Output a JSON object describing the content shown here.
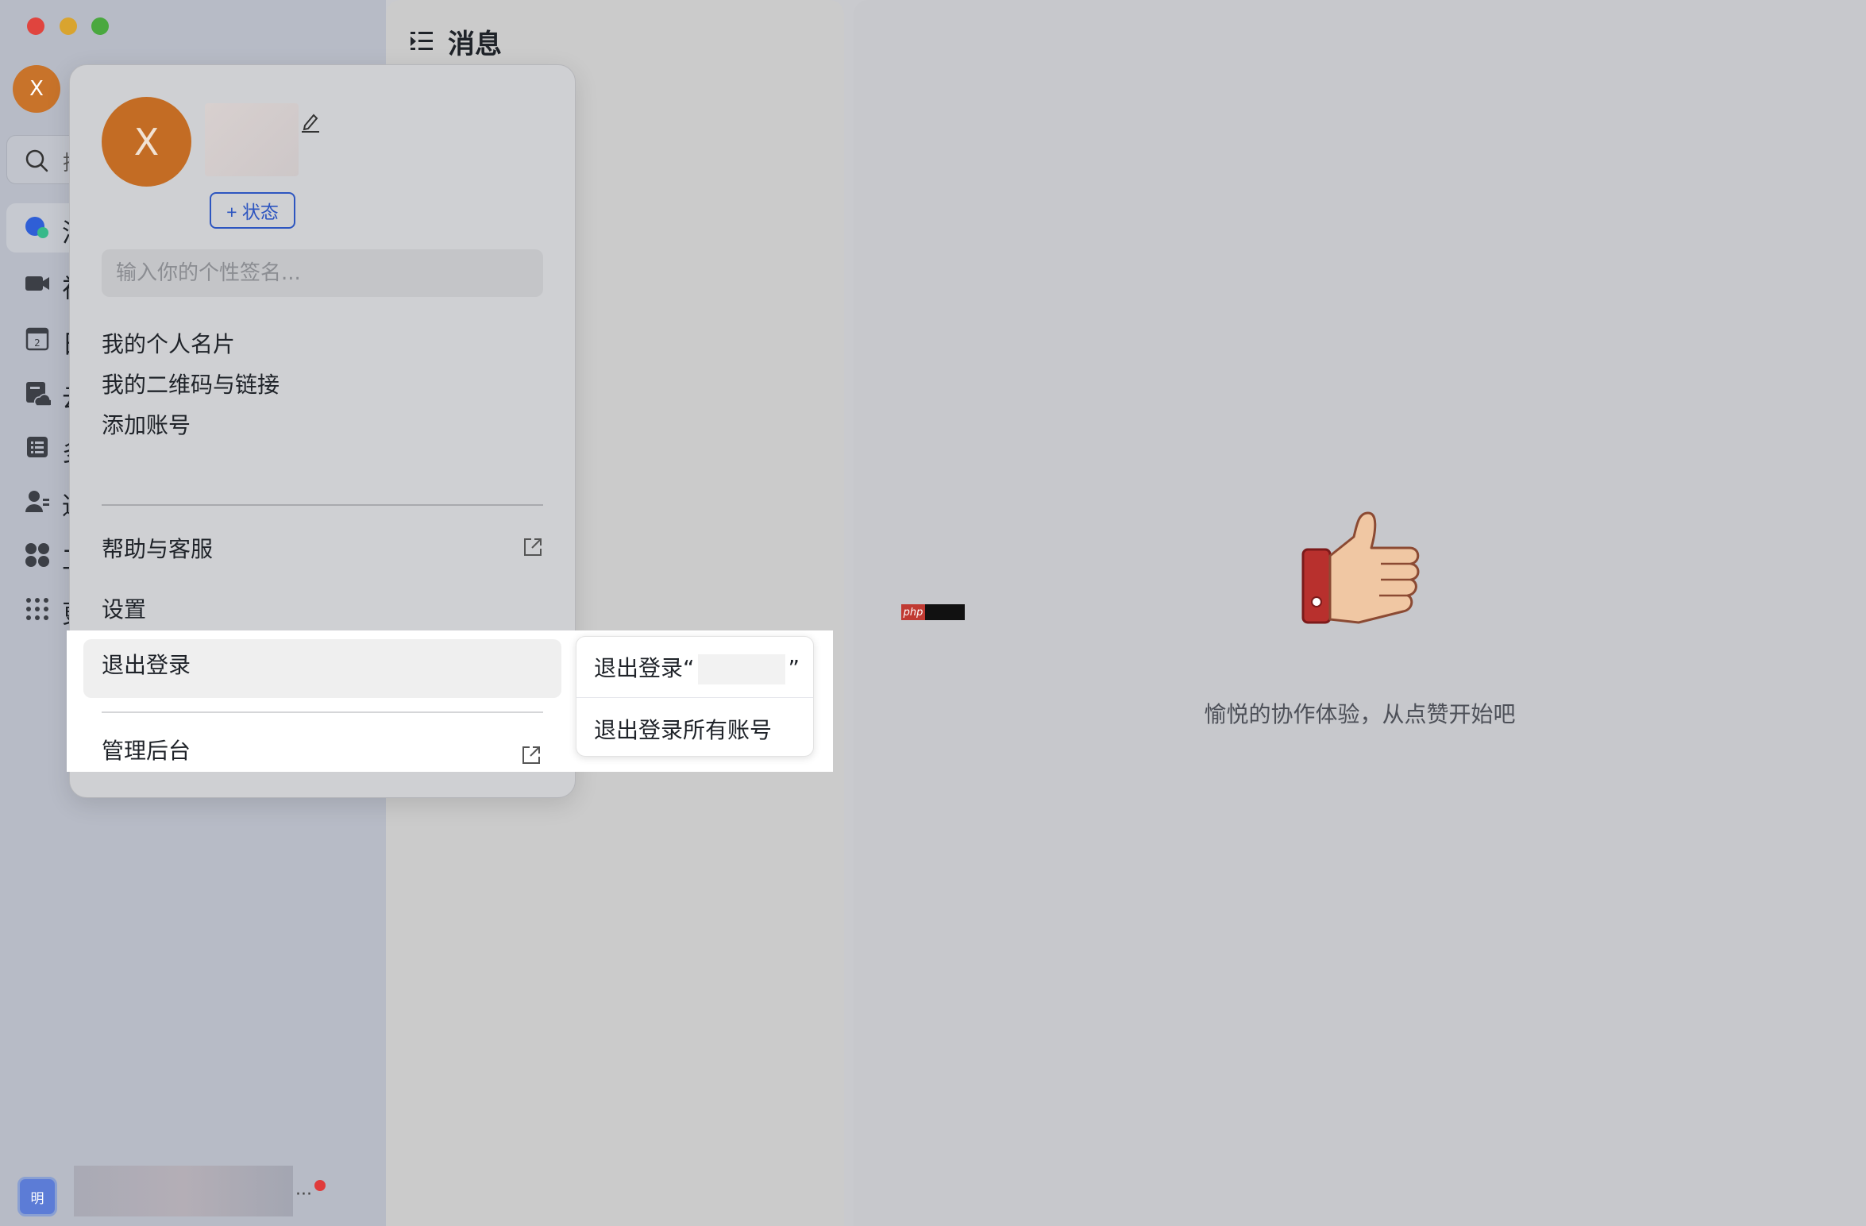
{
  "sidebar": {
    "avatar_letter": "X",
    "search_partial": "搜",
    "nav": [
      {
        "label": "消",
        "icon": "chat-bubble-icon"
      },
      {
        "label": "视",
        "icon": "video-camera-icon"
      },
      {
        "label": "日",
        "icon": "calendar-icon"
      },
      {
        "label": "云",
        "icon": "cloud-docs-icon"
      },
      {
        "label": "多",
        "icon": "list-icon"
      },
      {
        "label": "通",
        "icon": "contacts-icon"
      },
      {
        "label": "工",
        "icon": "workplace-icon"
      },
      {
        "label": "更",
        "icon": "more-apps-icon"
      }
    ],
    "bottom_badge": "明",
    "more": "···"
  },
  "middle": {
    "title": "消息"
  },
  "right": {
    "empty_text": "愉悦的协作体验，从点赞开始吧",
    "php_badge": "php"
  },
  "popup": {
    "avatar_letter": "X",
    "status_button": "+ 状态",
    "signature_placeholder": "输入你的个性签名...",
    "items": {
      "card": "我的个人名片",
      "qr": "我的二维码与链接",
      "add_account": "添加账号",
      "help": "帮助与客服",
      "settings": "设置",
      "logout": "退出登录",
      "admin": "管理后台"
    }
  },
  "submenu": {
    "logout_prefix": "退出登录“",
    "logout_suffix": "”",
    "logout_all": "退出登录所有账号"
  },
  "colors": {
    "accent": "#2d55c0",
    "avatar": "#c36c24",
    "notification": "#e03b3b"
  }
}
